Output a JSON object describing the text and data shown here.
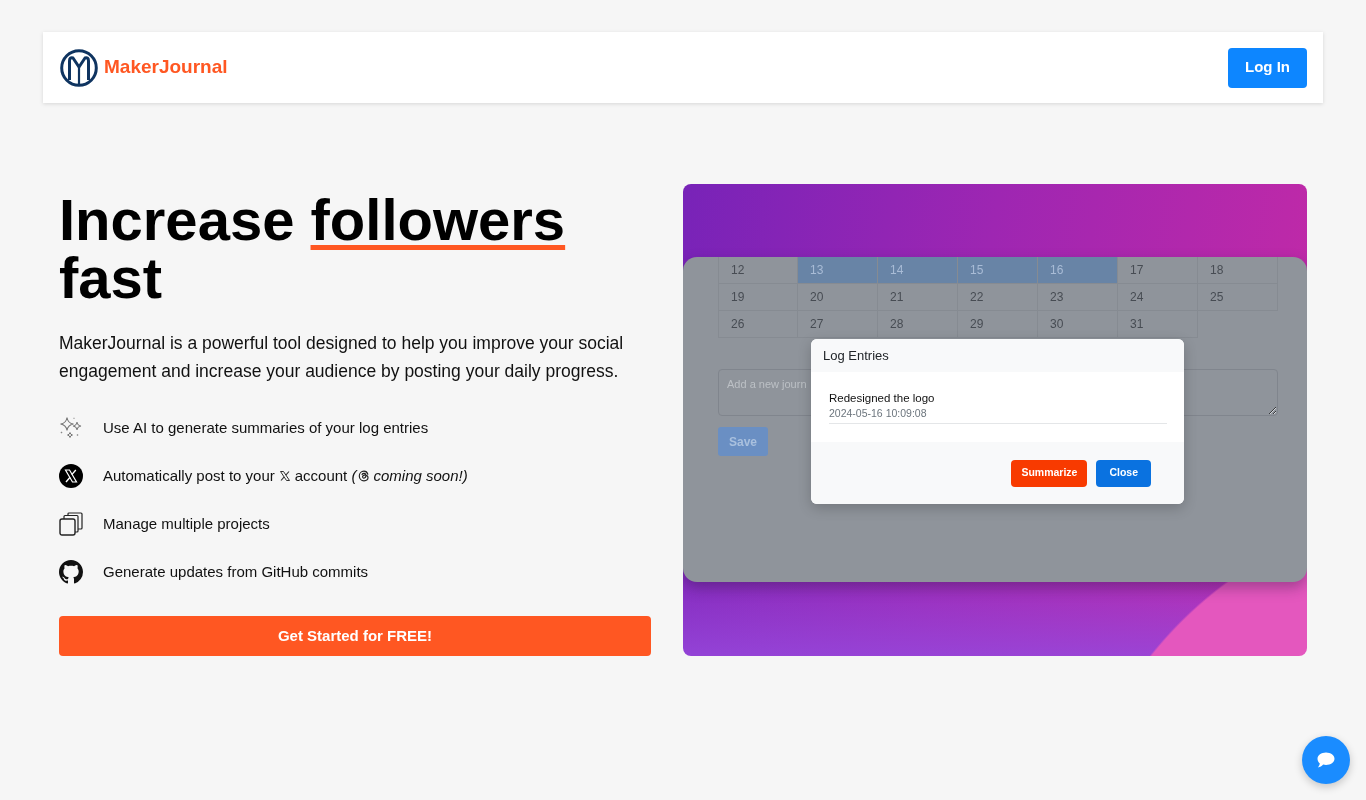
{
  "header": {
    "brand": "MakerJournal",
    "login_button": "Log In"
  },
  "hero": {
    "heading": [
      {
        "text": "Increase",
        "underlined": false
      },
      {
        "text": "followers",
        "underlined": true
      },
      {
        "text": "fast",
        "underlined": false
      }
    ],
    "description": "MakerJournal is a powerful tool designed to help you improve your social engagement and increase your audience by posting your daily progress.",
    "features": [
      {
        "text": "Use AI to generate summaries of your log entries"
      },
      {
        "text": "Automatically post to your",
        "after_logo": "account *(*",
        "note": "coming soon!)"
      },
      {
        "text": "Manage multiple projects"
      },
      {
        "text": "Generate updates from GitHub commits"
      }
    ],
    "cta_button": "Get Started for FREE!"
  },
  "app_preview": {
    "calendar": {
      "weeks": [
        [
          {
            "day": "12",
            "selected": false
          },
          {
            "day": "13",
            "selected": true
          },
          {
            "day": "14",
            "selected": true
          },
          {
            "day": "15",
            "selected": true
          },
          {
            "day": "16",
            "selected": true
          },
          {
            "day": "17",
            "selected": false
          },
          {
            "day": "18",
            "selected": false
          }
        ],
        [
          {
            "day": "19",
            "selected": false
          },
          {
            "day": "20",
            "selected": false
          },
          {
            "day": "21",
            "selected": false
          },
          {
            "day": "22",
            "selected": false
          },
          {
            "day": "23",
            "selected": false
          },
          {
            "day": "24",
            "selected": false
          },
          {
            "day": "25",
            "selected": false
          }
        ],
        [
          {
            "day": "26",
            "selected": false
          },
          {
            "day": "27",
            "selected": false
          },
          {
            "day": "28",
            "selected": false
          },
          {
            "day": "29",
            "selected": false
          },
          {
            "day": "30",
            "selected": false
          },
          {
            "day": "31",
            "selected": false
          }
        ]
      ]
    },
    "entry_field": {
      "placeholder": "Add a new journ"
    },
    "save_button": "Save",
    "modal": {
      "title": "Log Entries",
      "entries": [
        {
          "title": "Redesigned the logo",
          "timestamp": "2024-05-16 10:09:08"
        }
      ],
      "buttons": [
        {
          "label": "Summarize",
          "kind": "accent"
        },
        {
          "label": "Close",
          "kind": "primary"
        }
      ]
    }
  }
}
